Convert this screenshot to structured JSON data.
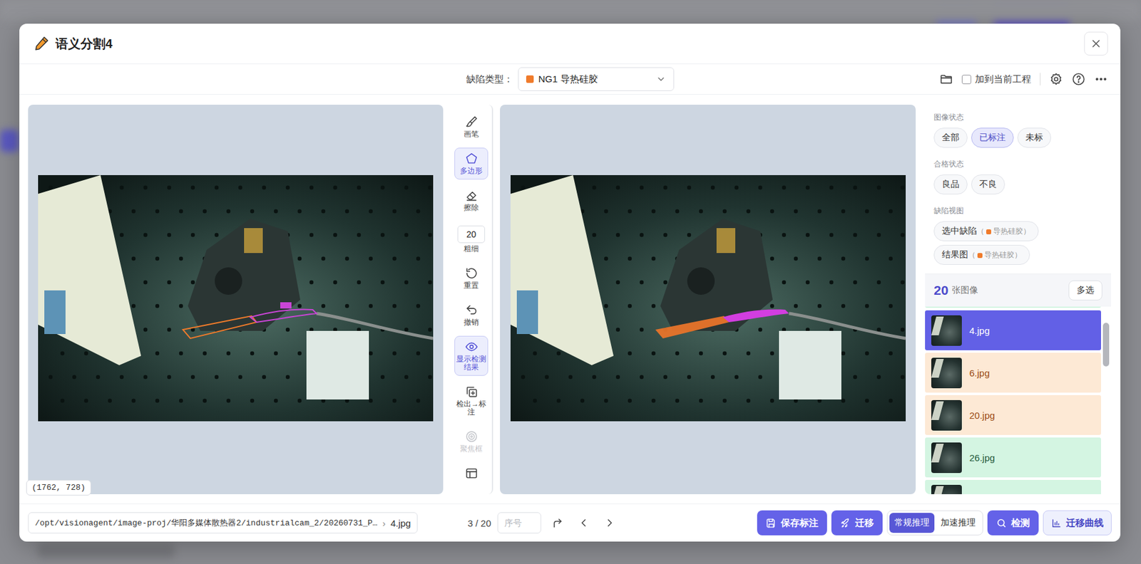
{
  "dialog": {
    "title": "语义分割4"
  },
  "toolbar": {
    "defect_label": "缺陷类型：",
    "defect": {
      "label": "NG1 导热硅胶",
      "color": "#f07b2b"
    },
    "add_to_project": {
      "label": "加到当前工程",
      "checked": false
    }
  },
  "tools": [
    {
      "kind": "brush",
      "label": "画笔",
      "selected": false,
      "disabled": false
    },
    {
      "kind": "polygon",
      "label": "多边形",
      "selected": true,
      "disabled": false
    },
    {
      "kind": "eraser",
      "label": "擦除",
      "selected": false,
      "disabled": false
    },
    {
      "kind": "size",
      "value": "20",
      "label": "粗细",
      "selected": false,
      "disabled": false
    },
    {
      "kind": "reset",
      "label": "重置",
      "selected": false,
      "disabled": false
    },
    {
      "kind": "undo",
      "label": "撤销",
      "selected": false,
      "disabled": false
    },
    {
      "kind": "eye",
      "label": "显示检测结果",
      "selected": true,
      "disabled": false
    },
    {
      "kind": "copy",
      "label": "检出→标注",
      "selected": false,
      "disabled": false
    },
    {
      "kind": "focus",
      "label": "聚焦框",
      "selected": false,
      "disabled": true
    },
    {
      "kind": "frame",
      "selected": false,
      "disabled": false
    }
  ],
  "canvas": {
    "coords": "(1762, 728)"
  },
  "sidebar": {
    "groups": [
      {
        "label": "图像状态",
        "options": [
          {
            "label": "全部",
            "selected": false
          },
          {
            "label": "已标注",
            "selected": true
          },
          {
            "label": "未标",
            "selected": false
          }
        ]
      },
      {
        "label": "合格状态",
        "options": [
          {
            "label": "良品",
            "selected": false
          },
          {
            "label": "不良",
            "selected": false
          }
        ]
      }
    ],
    "defect_view": {
      "label": "缺陷视图",
      "options": [
        {
          "label": "选中缺陷",
          "open": "（",
          "tag": "导热硅胶",
          "close": "）",
          "color": "#f07b2b"
        },
        {
          "label": "结果图",
          "open": "（",
          "tag": "导热硅胶",
          "close": "）",
          "color": "#f07b2b"
        }
      ]
    },
    "count": "20",
    "count_unit": "张图像",
    "multi_select": "多选",
    "images": [
      {
        "color": "#d4f5e2",
        "selected": false
      },
      {
        "label": "4.jpg",
        "selected": true
      },
      {
        "label": "6.jpg",
        "color": "#fde9d5",
        "selected": false
      },
      {
        "label": "20.jpg",
        "color": "#fde9d5",
        "selected": false
      },
      {
        "label": "26.jpg",
        "color": "#d4f5e2",
        "selected": false
      },
      {
        "color": "#d4f5e2",
        "selected": false
      }
    ]
  },
  "footer": {
    "path": "/opt/visionagent/image-proj/华阳多媒体散热器2/industrialcam_2/20260731_P…",
    "separator": "›",
    "file": "4.jpg",
    "position": "3 / 20",
    "index_placeholder": "序号",
    "save": "保存标注",
    "migrate": "迁移",
    "inference": [
      {
        "label": "常规推理",
        "selected": true
      },
      {
        "label": "加速推理",
        "selected": false
      }
    ],
    "detect": "检测",
    "curve": "迁移曲线"
  }
}
